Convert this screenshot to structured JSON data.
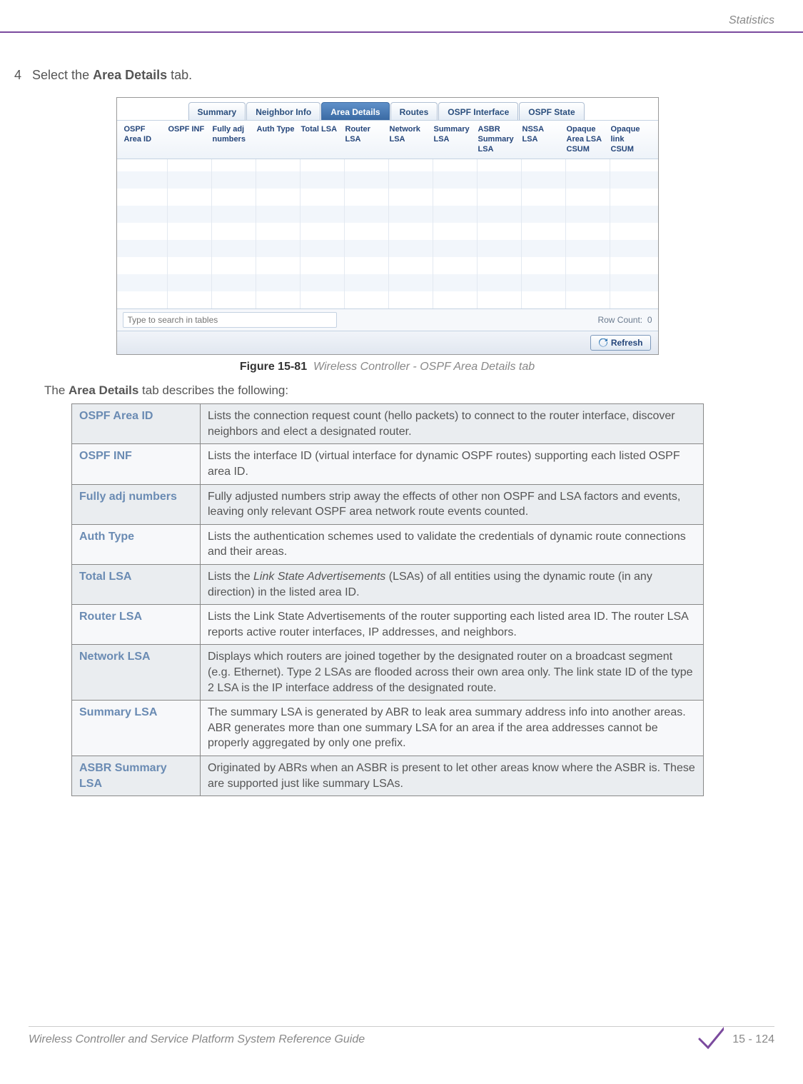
{
  "header": {
    "section": "Statistics"
  },
  "step": {
    "num": "4",
    "pre": "Select the ",
    "boldTab": "Area Details",
    "post": " tab."
  },
  "screenshot": {
    "tabs": [
      "Summary",
      "Neighbor Info",
      "Area Details",
      "Routes",
      "OSPF Interface",
      "OSPF State"
    ],
    "activeTab": "Area Details",
    "columns": [
      "OSPF Area ID",
      "OSPF INF",
      "Fully adj numbers",
      "Auth Type",
      "Total LSA",
      "Router LSA",
      "Network LSA",
      "Summary LSA",
      "ASBR Summary LSA",
      "NSSA LSA",
      "Opaque Area LSA CSUM",
      "Opaque link CSUM"
    ],
    "searchPlaceholder": "Type to search in tables",
    "rowCountLabel": "Row Count:",
    "rowCountValue": "0",
    "refreshLabel": "Refresh"
  },
  "figure": {
    "label": "Figure 15-81",
    "caption": "Wireless Controller - OSPF Area Details tab"
  },
  "intro": {
    "pre": "The ",
    "bold": "Area Details",
    "post": " tab describes the following:"
  },
  "definitions": [
    {
      "term": "OSPF Area ID",
      "desc": "Lists the connection request count (hello packets) to connect to the router interface, discover neighbors and elect a designated router."
    },
    {
      "term": "OSPF INF",
      "desc": "Lists the interface ID (virtual interface for dynamic OSPF routes) supporting each listed OSPF area ID."
    },
    {
      "term": "Fully adj numbers",
      "desc": "Fully adjusted numbers strip away the effects of other non OSPF and LSA factors and events, leaving only relevant OSPF area network route events counted."
    },
    {
      "term": "Auth Type",
      "desc": "Lists the authentication schemes used to validate the credentials of dynamic route connections and their areas."
    },
    {
      "term": "Total LSA",
      "desc_pre": "Lists the ",
      "desc_italic": "Link State Advertisements",
      "desc_post": " (LSAs) of all entities using the dynamic route (in any direction) in the listed area ID."
    },
    {
      "term": "Router LSA",
      "desc": "Lists the Link State Advertisements of the router supporting each listed area ID. The router LSA reports active router interfaces, IP addresses, and neighbors."
    },
    {
      "term": "Network LSA",
      "desc": "Displays which routers are joined together by the designated router on a broadcast segment (e.g. Ethernet). Type 2 LSAs are flooded across their own area only. The link state ID of the type 2 LSA is the IP interface address of the designated route."
    },
    {
      "term": "Summary LSA",
      "desc": "The summary LSA is generated by ABR to leak area summary address info into another areas. ABR generates more than one summary LSA for an area if the area addresses cannot be properly aggregated by only one prefix."
    },
    {
      "term": "ASBR Summary LSA",
      "desc": "Originated by ABRs when an ASBR is present to let other areas know where the ASBR is. These are supported just like summary LSAs."
    }
  ],
  "footer": {
    "title": "Wireless Controller and Service Platform System Reference Guide",
    "page": "15 - 124"
  }
}
